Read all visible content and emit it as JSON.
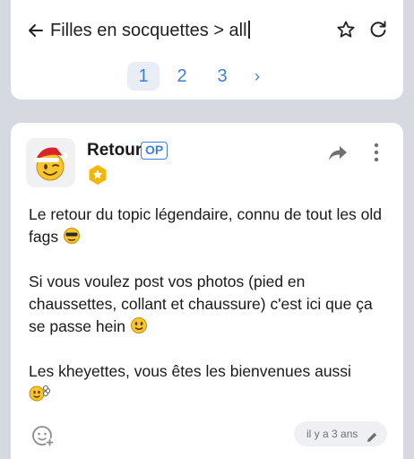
{
  "header": {
    "title": "Filles en socquettes > all",
    "back_icon": "arrow-left-icon",
    "favorite_icon": "star-outline-icon",
    "refresh_icon": "refresh-icon"
  },
  "pagination": {
    "pages": [
      "1",
      "2",
      "3"
    ],
    "current": "1",
    "next_label": "›"
  },
  "post": {
    "author": "Retour",
    "op_badge": "OP",
    "paragraphs": [
      "Le retour du topic légendaire, connu de tout les old fags",
      "Si vous voulez post vos photos (pied en chaussettes, collant et chaussure) c'est ici que ça se passe hein",
      "Les kheyettes, vous êtes les bienvenues aussi"
    ],
    "timestamp": "il y a 3 ans"
  },
  "colors": {
    "accent": "#3d7fd6",
    "background": "#d6dae0",
    "card": "#ffffff",
    "badge_gold": "#f2b705"
  }
}
